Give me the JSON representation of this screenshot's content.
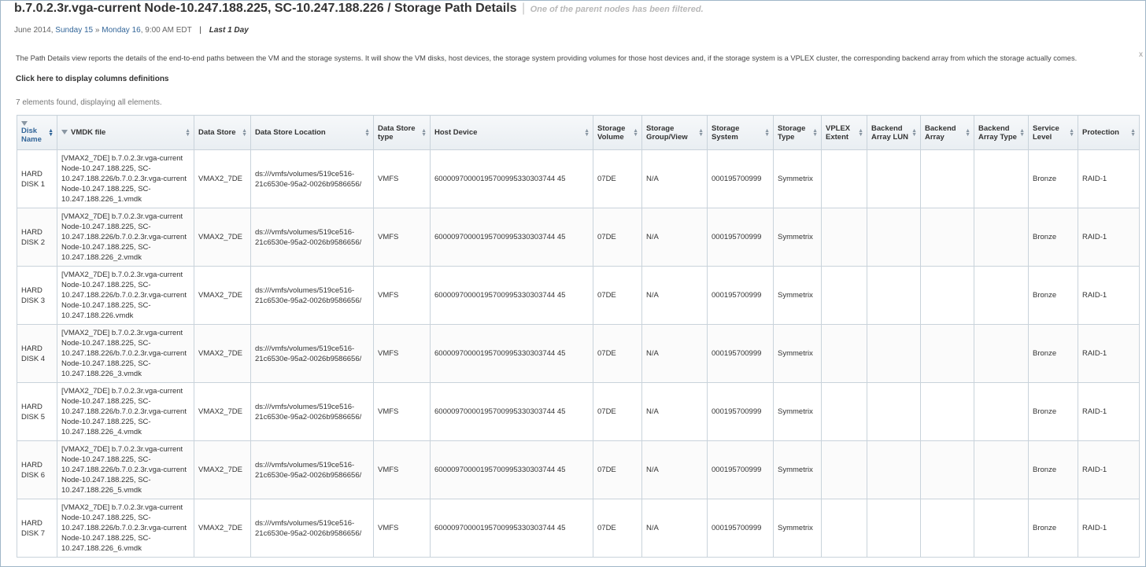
{
  "header": {
    "title": "b.7.0.2.3r.vga-current Node-10.247.188.225, SC-10.247.188.226 / Storage Path Details",
    "separator": "|",
    "note": "One of the parent nodes has been filtered."
  },
  "date": {
    "prefix": "June 2014,",
    "start": "Sunday 15",
    "arrow": "»",
    "end": "Monday 16",
    "time": ", 9:00 AM EDT",
    "divider": "|",
    "range": "Last 1 Day"
  },
  "description": "The Path Details view reports the details of the end-to-end paths between the VM and the storage systems. It will show the VM disks, host devices, the storage system providing volumes for those host devices and, if the storage system is a VPLEX cluster, the corresponding backend array from which the storage actually comes.",
  "columns_link": "Click here to display columns definitions",
  "close_glyph": "x",
  "count_text": "7 elements found, displaying all elements.",
  "table": {
    "headers": [
      "Disk Name",
      "VMDK file",
      "Data Store",
      "Data Store Location",
      "Data Store type",
      "Host Device",
      "Storage Volume",
      "Storage Group/View",
      "Storage System",
      "Storage Type",
      "VPLEX Extent",
      "Backend Array LUN",
      "Backend Array",
      "Backend Array Type",
      "Service Level",
      "Protection"
    ],
    "rows": [
      [
        "HARD DISK 1",
        "[VMAX2_7DE] b.7.0.2.3r.vga-current Node-10.247.188.225, SC-10.247.188.226/b.7.0.2.3r.vga-current Node-10.247.188.225, SC-10.247.188.226_1.vmdk",
        "VMAX2_7DE",
        "ds:///vmfs/volumes/519ce516-21c6530e-95a2-0026b9586656/",
        "VMFS",
        "60000970000195700995330303744 45",
        "07DE",
        "N/A",
        "000195700999",
        "Symmetrix",
        "",
        "",
        "",
        "",
        "Bronze",
        "RAID-1"
      ],
      [
        "HARD DISK 2",
        "[VMAX2_7DE] b.7.0.2.3r.vga-current Node-10.247.188.225, SC-10.247.188.226/b.7.0.2.3r.vga-current Node-10.247.188.225, SC-10.247.188.226_2.vmdk",
        "VMAX2_7DE",
        "ds:///vmfs/volumes/519ce516-21c6530e-95a2-0026b9586656/",
        "VMFS",
        "60000970000195700995330303744 45",
        "07DE",
        "N/A",
        "000195700999",
        "Symmetrix",
        "",
        "",
        "",
        "",
        "Bronze",
        "RAID-1"
      ],
      [
        "HARD DISK 3",
        "[VMAX2_7DE] b.7.0.2.3r.vga-current Node-10.247.188.225, SC-10.247.188.226/b.7.0.2.3r.vga-current Node-10.247.188.225, SC-10.247.188.226.vmdk",
        "VMAX2_7DE",
        "ds:///vmfs/volumes/519ce516-21c6530e-95a2-0026b9586656/",
        "VMFS",
        "60000970000195700995330303744 45",
        "07DE",
        "N/A",
        "000195700999",
        "Symmetrix",
        "",
        "",
        "",
        "",
        "Bronze",
        "RAID-1"
      ],
      [
        "HARD DISK 4",
        "[VMAX2_7DE] b.7.0.2.3r.vga-current Node-10.247.188.225, SC-10.247.188.226/b.7.0.2.3r.vga-current Node-10.247.188.225, SC-10.247.188.226_3.vmdk",
        "VMAX2_7DE",
        "ds:///vmfs/volumes/519ce516-21c6530e-95a2-0026b9586656/",
        "VMFS",
        "60000970000195700995330303744 45",
        "07DE",
        "N/A",
        "000195700999",
        "Symmetrix",
        "",
        "",
        "",
        "",
        "Bronze",
        "RAID-1"
      ],
      [
        "HARD DISK 5",
        "[VMAX2_7DE] b.7.0.2.3r.vga-current Node-10.247.188.225, SC-10.247.188.226/b.7.0.2.3r.vga-current Node-10.247.188.225, SC-10.247.188.226_4.vmdk",
        "VMAX2_7DE",
        "ds:///vmfs/volumes/519ce516-21c6530e-95a2-0026b9586656/",
        "VMFS",
        "60000970000195700995330303744 45",
        "07DE",
        "N/A",
        "000195700999",
        "Symmetrix",
        "",
        "",
        "",
        "",
        "Bronze",
        "RAID-1"
      ],
      [
        "HARD DISK 6",
        "[VMAX2_7DE] b.7.0.2.3r.vga-current Node-10.247.188.225, SC-10.247.188.226/b.7.0.2.3r.vga-current Node-10.247.188.225, SC-10.247.188.226_5.vmdk",
        "VMAX2_7DE",
        "ds:///vmfs/volumes/519ce516-21c6530e-95a2-0026b9586656/",
        "VMFS",
        "60000970000195700995330303744 45",
        "07DE",
        "N/A",
        "000195700999",
        "Symmetrix",
        "",
        "",
        "",
        "",
        "Bronze",
        "RAID-1"
      ],
      [
        "HARD DISK 7",
        "[VMAX2_7DE] b.7.0.2.3r.vga-current Node-10.247.188.225, SC-10.247.188.226/b.7.0.2.3r.vga-current Node-10.247.188.225, SC-10.247.188.226_6.vmdk",
        "VMAX2_7DE",
        "ds:///vmfs/volumes/519ce516-21c6530e-95a2-0026b9586656/",
        "VMFS",
        "60000970000195700995330303744 45",
        "07DE",
        "N/A",
        "000195700999",
        "Symmetrix",
        "",
        "",
        "",
        "",
        "Bronze",
        "RAID-1"
      ]
    ]
  },
  "colors": {
    "link": "#336699",
    "border": "#c9d3db",
    "header_bg": "#e9eef2",
    "note": "#b8b8b8"
  },
  "icons": {
    "filter": "filter-icon",
    "sort": "sort-arrows-icon"
  }
}
